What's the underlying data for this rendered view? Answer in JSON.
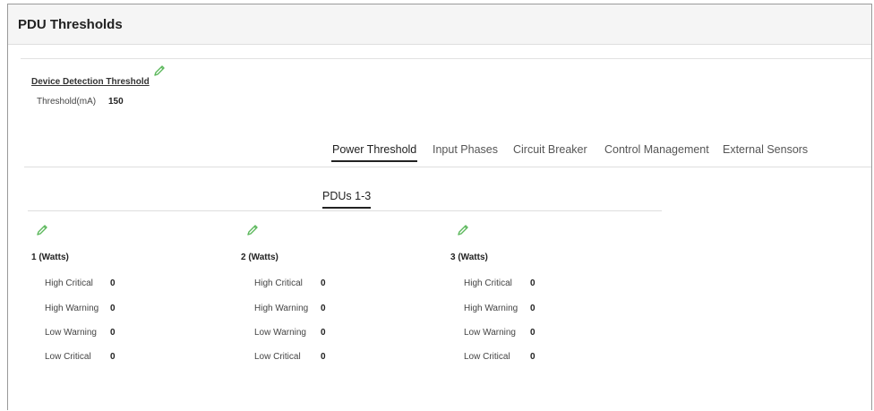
{
  "page": {
    "title": "PDU Thresholds"
  },
  "device_detection": {
    "link_label": "Device Detection Threshold",
    "threshold_label": "Threshold(mA)",
    "threshold_value": "150"
  },
  "tabs": [
    {
      "label": "Power Threshold",
      "active": true
    },
    {
      "label": "Input Phases",
      "active": false
    },
    {
      "label": "Circuit Breaker",
      "active": false
    },
    {
      "label": "Control Management",
      "active": false
    },
    {
      "label": "External Sensors",
      "active": false
    }
  ],
  "sub_tab": {
    "label": "PDUs 1-3"
  },
  "pdus": [
    {
      "title": "1 (Watts)",
      "rows": [
        {
          "label": "High Critical",
          "value": "0"
        },
        {
          "label": "High Warning",
          "value": "0"
        },
        {
          "label": "Low Warning",
          "value": "0"
        },
        {
          "label": "Low Critical",
          "value": "0"
        }
      ]
    },
    {
      "title": "2 (Watts)",
      "rows": [
        {
          "label": "High Critical",
          "value": "0"
        },
        {
          "label": "High Warning",
          "value": "0"
        },
        {
          "label": "Low Warning",
          "value": "0"
        },
        {
          "label": "Low Critical",
          "value": "0"
        }
      ]
    },
    {
      "title": "3 (Watts)",
      "rows": [
        {
          "label": "High Critical",
          "value": "0"
        },
        {
          "label": "High Warning",
          "value": "0"
        },
        {
          "label": "Low Warning",
          "value": "0"
        },
        {
          "label": "Low Critical",
          "value": "0"
        }
      ]
    }
  ],
  "icons": {
    "edit": "pencil-icon"
  },
  "colors": {
    "edit_icon": "#5cb85c",
    "active_tab": "#222222"
  }
}
